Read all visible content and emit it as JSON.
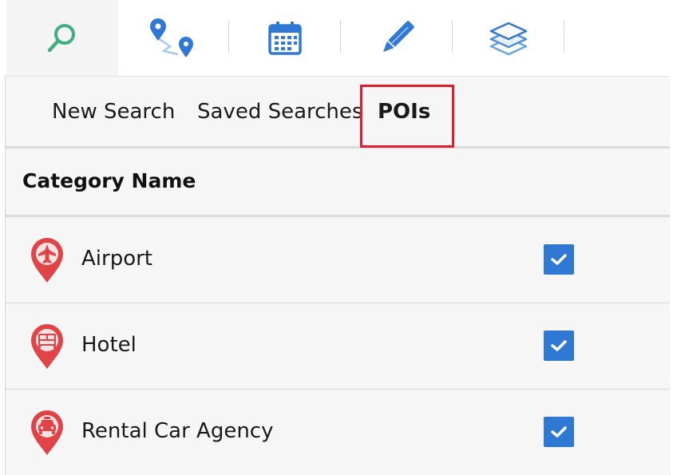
{
  "colors": {
    "accent_blue": "#2f78d3",
    "search_green": "#3fae7f",
    "highlight_red": "#e21b2c",
    "pin_red": "#e04446"
  },
  "toolbar": {
    "tools": [
      {
        "icon": "search-icon",
        "active": true
      },
      {
        "icon": "route-icon",
        "active": false
      },
      {
        "icon": "calendar-icon",
        "active": false
      },
      {
        "icon": "pencil-icon",
        "active": false
      },
      {
        "icon": "layers-icon",
        "active": false
      }
    ]
  },
  "tabs": {
    "new_search": "New Search",
    "saved_searches": "Saved Searches",
    "pois": "POIs",
    "selected": "POIs"
  },
  "table": {
    "header": "Category Name",
    "rows": [
      {
        "label": "Airport",
        "icon": "airplane-icon",
        "checked": true
      },
      {
        "label": "Hotel",
        "icon": "bed-icon",
        "checked": true
      },
      {
        "label": "Rental Car Agency",
        "icon": "car-icon",
        "checked": true
      }
    ]
  }
}
